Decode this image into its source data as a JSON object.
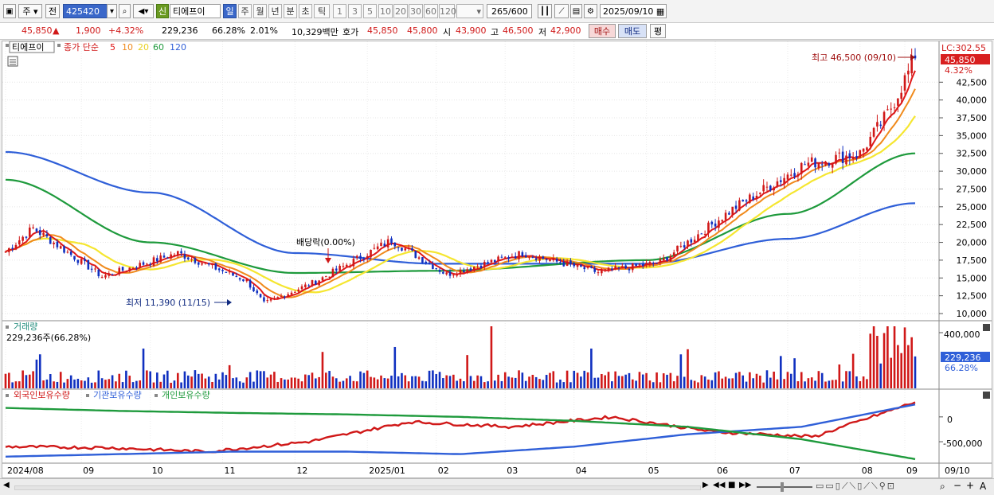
{
  "toolbar": {
    "type_label": "주",
    "prefix_label": "전",
    "code": "425420",
    "badge": "신",
    "name": "티에프이",
    "periods": [
      "일",
      "주",
      "월",
      "년",
      "분",
      "초",
      "틱"
    ],
    "active_period": "일",
    "intervals": [
      "1",
      "3",
      "5",
      "10",
      "20",
      "30",
      "60",
      "120"
    ],
    "count": "265",
    "count_max": "/600",
    "date": "2025/09/10"
  },
  "quote": {
    "price": "45,850",
    "arrow": "▲",
    "change": "1,900",
    "change_pct": "+4.32%",
    "volume": "229,236",
    "vol_ratio": "66.28%",
    "turnover_ratio": "2.01%",
    "amount": "10,329백만",
    "ask_label": "호가",
    "ask": "45,850",
    "bid": "45,800",
    "open_label": "시",
    "open": "43,900",
    "high_label": "고",
    "high": "46,500",
    "low_label": "저",
    "low": "42,900",
    "buy_label": "매수",
    "sell_label": "매도",
    "eval_label": "평"
  },
  "legend": {
    "name": "티에프이",
    "ma_label": "종가 단순",
    "ma_periods": [
      "5",
      "10",
      "20",
      "60",
      "120"
    ]
  },
  "colors": {
    "up": "#d01818",
    "down": "#1030c0",
    "ma5": "#e01818",
    "ma10": "#f08a1c",
    "ma20": "#f5e630",
    "ma60": "#1e9a3c",
    "ma120": "#2f5fd8",
    "foreign": "#d01818",
    "inst": "#2f5fd8",
    "indiv": "#1e9a3c"
  },
  "annotations": {
    "max_label": "최고 46,500 (09/10)",
    "min_label": "최저 11,390 (11/15)",
    "dividend_label": "배당락(0.00%)"
  },
  "price_axis": {
    "lc": "LC:302.55",
    "price_box": "45,850",
    "pct": "4.32%",
    "ticks": [
      "42,500",
      "40,000",
      "37,500",
      "35,000",
      "32,500",
      "30,000",
      "27,500",
      "25,000",
      "22,500",
      "20,000",
      "17,500",
      "15,000",
      "12,500",
      "10,000"
    ]
  },
  "volume_panel": {
    "title": "거래량",
    "info": "229,236주(66.28%)",
    "axis_tick": "400,000",
    "box": "229,236",
    "pct": "66.28%"
  },
  "holding_panel": {
    "labels": [
      "외국인보유수량",
      "기관보유수량",
      "개인보유수량"
    ],
    "ticks": [
      "0",
      "-500,000"
    ]
  },
  "x_axis": {
    "labels": [
      "2024/08",
      "09",
      "10",
      "11",
      "12",
      "2025/01",
      "02",
      "03",
      "04",
      "05",
      "06",
      "07",
      "08",
      "09"
    ],
    "end_date": "09/10"
  },
  "chart_data": {
    "type": "candlestick",
    "x_range": [
      "2024/08",
      "2025/09/10"
    ],
    "price": {
      "ylim": [
        10000,
        47000
      ],
      "approx_close_path": [
        {
          "x": "2024/08",
          "y": 18700
        },
        {
          "x": "2024/08",
          "y": 22000
        },
        {
          "x": "09",
          "y": 15200
        },
        {
          "x": "10",
          "y": 18500
        },
        {
          "x": "11",
          "y": 14600
        },
        {
          "x": "11/15",
          "y": 11390
        },
        {
          "x": "12",
          "y": 14500
        },
        {
          "x": "2025/01",
          "y": 20300
        },
        {
          "x": "02",
          "y": 15500
        },
        {
          "x": "03",
          "y": 18500
        },
        {
          "x": "04",
          "y": 15800
        },
        {
          "x": "05",
          "y": 17200
        },
        {
          "x": "06",
          "y": 25000
        },
        {
          "x": "07",
          "y": 31000
        },
        {
          "x": "08",
          "y": 32500
        },
        {
          "x": "09",
          "y": 38000
        },
        {
          "x": "09/10",
          "y": 45850
        }
      ],
      "ma120_path": [
        {
          "x": "2024/08",
          "y": 32700
        },
        {
          "x": "10",
          "y": 27000
        },
        {
          "x": "12",
          "y": 18500
        },
        {
          "x": "02",
          "y": 17000
        },
        {
          "x": "05",
          "y": 17000
        },
        {
          "x": "07",
          "y": 20500
        },
        {
          "x": "09/10",
          "y": 25500
        }
      ],
      "ma60_path": [
        {
          "x": "2024/08",
          "y": 28800
        },
        {
          "x": "10",
          "y": 20000
        },
        {
          "x": "12",
          "y": 15700
        },
        {
          "x": "02",
          "y": 16000
        },
        {
          "x": "05",
          "y": 17500
        },
        {
          "x": "07",
          "y": 24000
        },
        {
          "x": "09/10",
          "y": 32500
        }
      ]
    },
    "volume": {
      "axis_max": 400000,
      "last": 229236
    },
    "holdings": {
      "series": [
        {
          "name": "외국인보유수량",
          "path": [
            -600000,
            -620000,
            -700000,
            -500000,
            -100000,
            -200000,
            0,
            -300000,
            -400000,
            300000
          ]
        },
        {
          "name": "기관보유수량",
          "path": [
            -800000,
            -750000,
            -700000,
            -700000,
            -750000,
            -600000,
            -350000,
            -200000,
            250000
          ]
        },
        {
          "name": "개인보유수량",
          "path": [
            180000,
            120000,
            80000,
            50000,
            0,
            -80000,
            -200000,
            -450000,
            -850000
          ]
        }
      ],
      "ticks": [
        0,
        -500000
      ]
    }
  }
}
